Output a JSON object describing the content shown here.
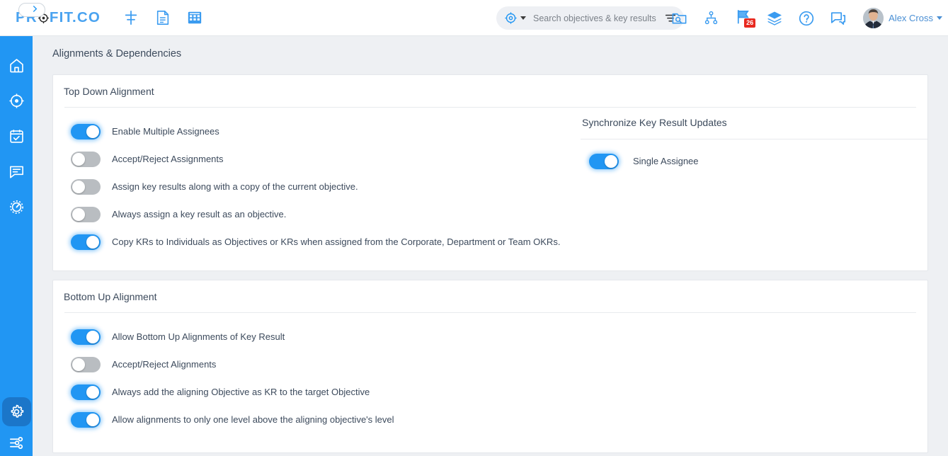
{
  "header": {
    "logo_text_1": "PR",
    "logo_text_2": "FIT.CO",
    "icons": [
      {
        "name": "align-distribute-icon",
        "label": "Align"
      },
      {
        "name": "document-icon",
        "label": "Documents"
      },
      {
        "name": "grid-table-icon",
        "label": "Grid"
      }
    ],
    "search": {
      "placeholder": "Search objectives & key results",
      "value": "",
      "scope_icon": "target-icon",
      "dropdown_icon": "caret-down-icon",
      "filter_icon": "filter-icon"
    },
    "right_icons": [
      {
        "name": "folder-search-icon",
        "label": "Explore"
      },
      {
        "name": "org-chart-icon",
        "label": "Org Chart"
      },
      {
        "name": "flag-icon",
        "label": "Notifications",
        "badge": "26"
      },
      {
        "name": "layers-icon",
        "label": "Layers"
      },
      {
        "name": "help-icon",
        "label": "Help"
      },
      {
        "name": "chat-icon",
        "label": "Chat"
      }
    ],
    "user": {
      "name": "Alex Cross",
      "avatar_name": "user-avatar",
      "caret_icon": "caret-down-icon"
    }
  },
  "sidebar": {
    "expand_button": {
      "name": "sidebar-expand-button",
      "icon": "chevron-right-icon"
    },
    "items": [
      {
        "name": "sidebar-item-home",
        "icon": "home-icon",
        "label": "Home"
      },
      {
        "name": "sidebar-item-objectives",
        "icon": "target-icon",
        "label": "Objectives"
      },
      {
        "name": "sidebar-item-tasks",
        "icon": "task-check-icon",
        "label": "Tasks"
      },
      {
        "name": "sidebar-item-conversations",
        "icon": "chat-bubble-icon",
        "label": "Conversations"
      },
      {
        "name": "sidebar-item-performance",
        "icon": "speedometer-icon",
        "label": "Performance"
      }
    ],
    "bottom_items": [
      {
        "name": "sidebar-item-settings",
        "icon": "gear-icon",
        "label": "Settings",
        "active": true
      },
      {
        "name": "sidebar-item-preferences",
        "icon": "sliders-icon",
        "label": "Preferences",
        "active": false
      }
    ]
  },
  "main": {
    "page_title": "Alignments & Dependencies",
    "cards": [
      {
        "title": "Top Down Alignment",
        "left_toggles": [
          {
            "label": "Enable Multiple Assignees",
            "state": "on"
          },
          {
            "label": "Accept/Reject Assignments",
            "state": "off"
          },
          {
            "label": "Assign key results along with a copy of the current objective.",
            "state": "off"
          },
          {
            "label": "Always assign a key result as an objective.",
            "state": "off"
          },
          {
            "label": "Copy KRs to Individuals as Objectives or KRs when assigned from the Corporate, Department or Team OKRs.",
            "state": "on"
          }
        ],
        "right_section": {
          "title": "Synchronize Key Result Updates",
          "toggles": [
            {
              "label": "Single Assignee",
              "state": "on"
            }
          ]
        }
      },
      {
        "title": "Bottom Up Alignment",
        "left_toggles": [
          {
            "label": "Allow Bottom Up Alignments of Key Result",
            "state": "on"
          },
          {
            "label": "Accept/Reject Alignments",
            "state": "off"
          },
          {
            "label": "Always add the aligning Objective as KR to the target Objective",
            "state": "on"
          },
          {
            "label": "Allow alignments to only one level above the aligning objective's level",
            "state": "on"
          }
        ]
      }
    ]
  },
  "colors": {
    "brand_blue": "#2196f3",
    "logo_blue": "#4aa3f0",
    "sidebar_blue": "#2196f3",
    "sidebar_active": "#1b76c9",
    "badge_red": "#e8291f",
    "toggle_off": "#b9bdc1",
    "page_bg": "#eef0f3",
    "card_bg": "#ffffff",
    "text": "#3c4a5c",
    "username_blue": "#4a8fd4"
  }
}
